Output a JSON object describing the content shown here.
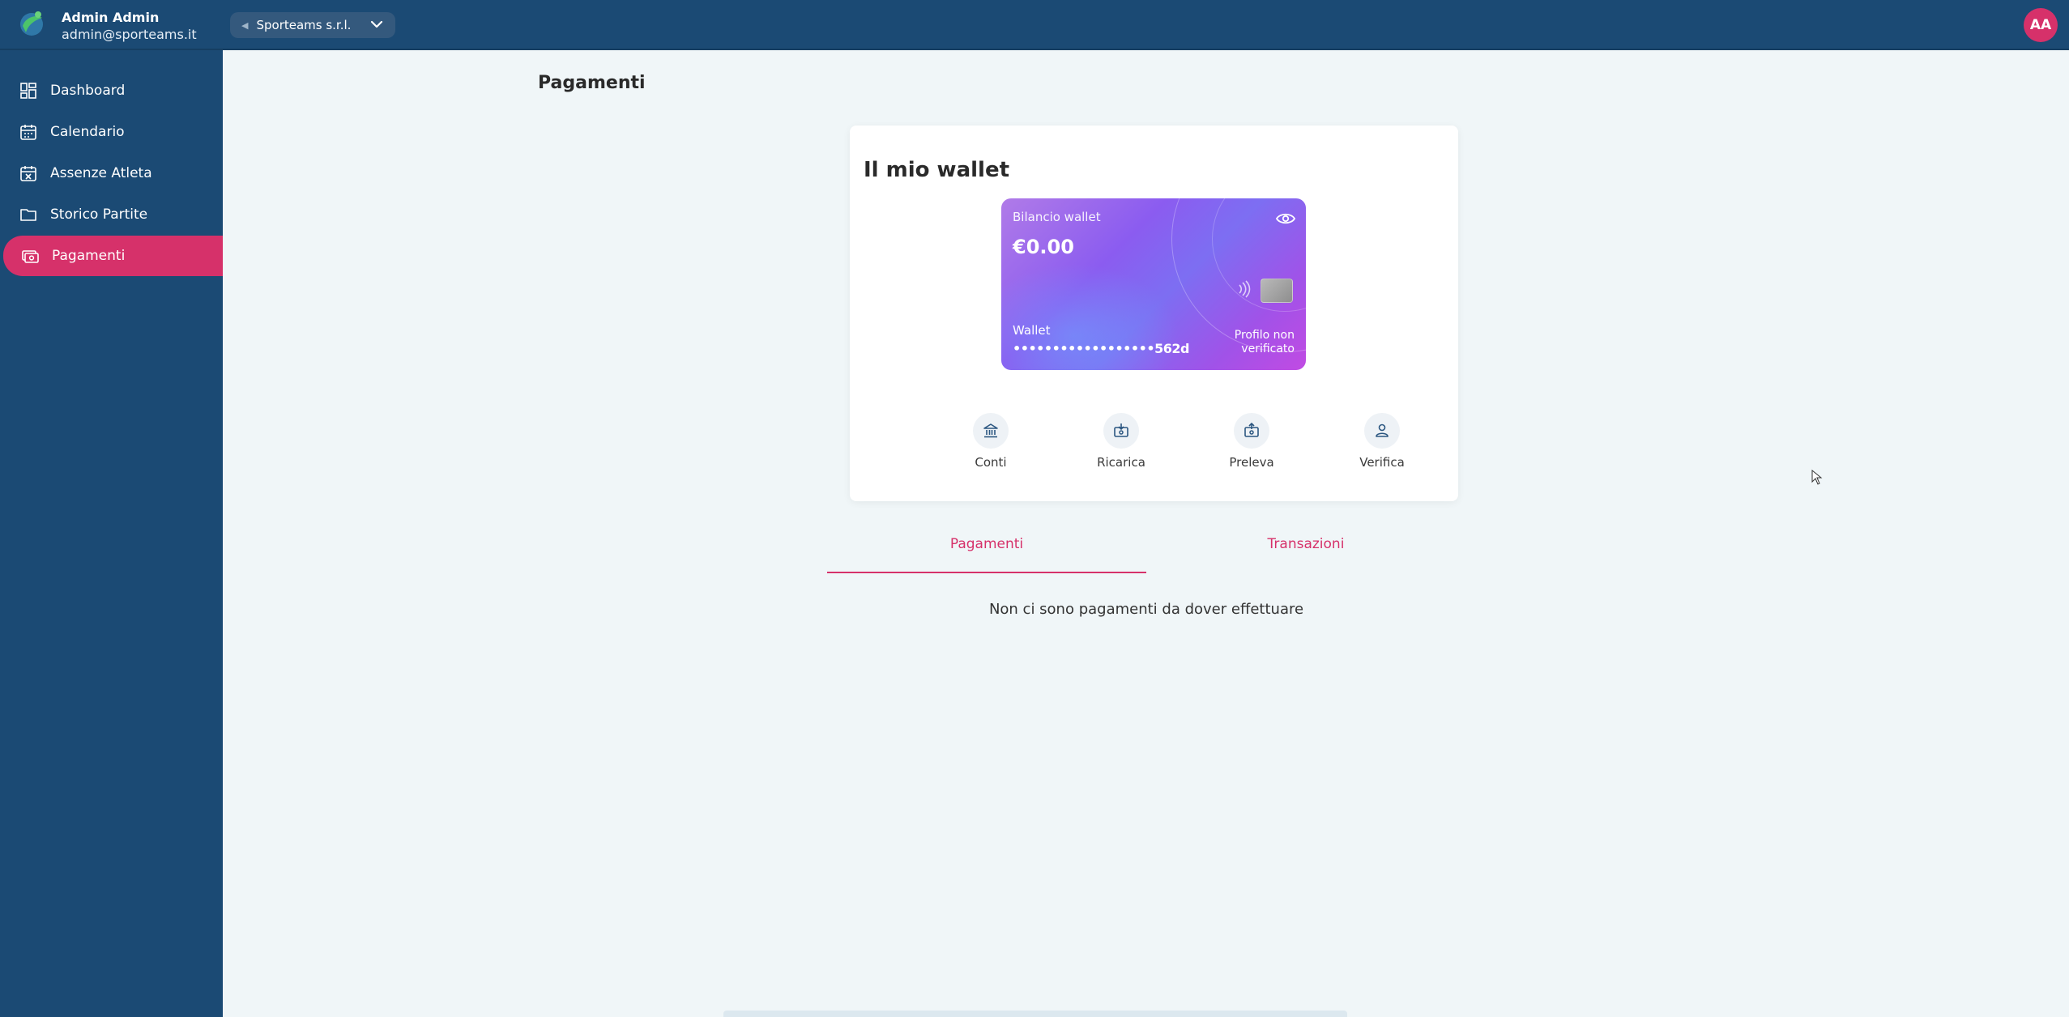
{
  "header": {
    "user_name": "Admin Admin",
    "user_email": "admin@sporteams.it",
    "org_select": {
      "value": "Sporteams s.r.l."
    },
    "avatar_initials": "AA"
  },
  "sidebar": {
    "items": [
      {
        "label": "Dashboard",
        "icon": "grid-icon"
      },
      {
        "label": "Calendario",
        "icon": "calendar-icon"
      },
      {
        "label": "Assenze Atleta",
        "icon": "calendar-x-icon"
      },
      {
        "label": "Storico Partite",
        "icon": "folder-icon"
      },
      {
        "label": "Pagamenti",
        "icon": "money-icon",
        "active": true
      }
    ]
  },
  "main": {
    "title": "Pagamenti",
    "wallet": {
      "title": "Il mio wallet",
      "balance_label": "Bilancio wallet",
      "balance": "€0.00",
      "wallet_label": "Wallet",
      "wallet_number": "••••••••••••••••••562d",
      "status_line1": "Profilo non",
      "status_line2": "verificato"
    },
    "actions": [
      {
        "label": "Conti",
        "icon": "bank-icon"
      },
      {
        "label": "Ricarica",
        "icon": "deposit-icon"
      },
      {
        "label": "Preleva",
        "icon": "withdraw-icon"
      },
      {
        "label": "Verifica",
        "icon": "user-check-icon"
      }
    ],
    "tabs": [
      {
        "label": "Pagamenti",
        "active": true
      },
      {
        "label": "Transazioni",
        "active": false
      }
    ],
    "empty_message": "Non ci sono pagamenti da dover effettuare"
  },
  "colors": {
    "primary": "#1b4a74",
    "accent": "#d6316a",
    "background": "#f0f6f8"
  }
}
